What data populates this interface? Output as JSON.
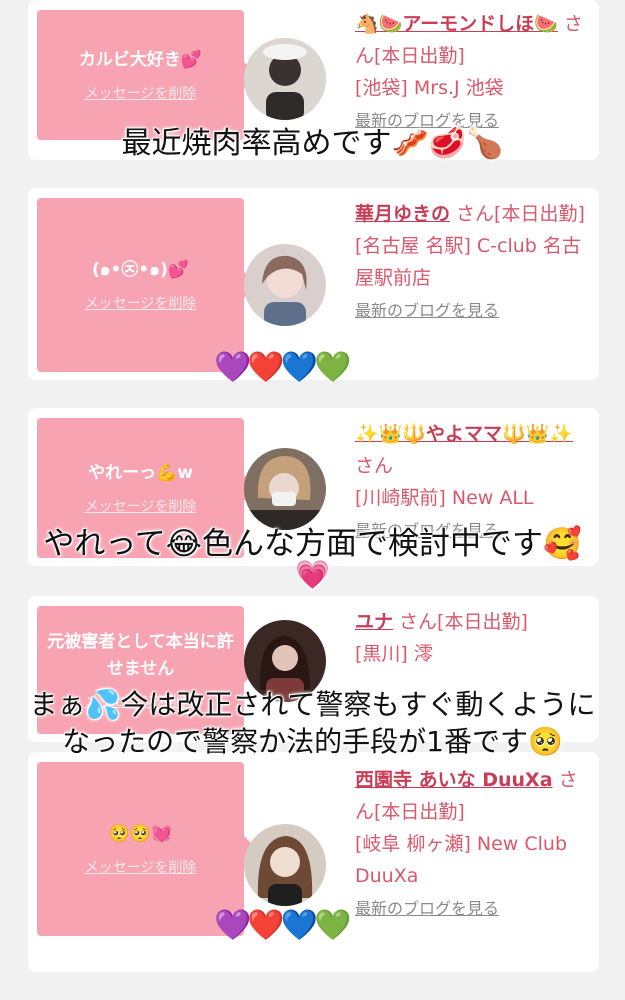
{
  "delete_label": "メッセージを削除",
  "blog_label": "最新のブログを見る",
  "cards": [
    {
      "message": "カルビ大好き💕",
      "name": "🐴🍉アーモンドしほ🍉",
      "san": " さん[本日出勤]",
      "shop": "[池袋] Mrs.J 池袋",
      "avatar_color": "#c9c2bd"
    },
    {
      "message": "(๑•㉨•๑)💕",
      "name": "華月ゆきの",
      "san": " さん[本日出勤]",
      "shop": "[名古屋 名駅] C-club 名古屋駅前店",
      "avatar_color": "#c7b7b4"
    },
    {
      "message": "やれーっ💪w",
      "name": "✨👑🔱やよママ🔱👑✨",
      "san": " さん",
      "shop": "[川崎駅前] New ALL",
      "avatar_color": "#8e7b6a"
    },
    {
      "message": "元被害者として本当に許せません",
      "name": "ユナ",
      "san": " さん[本日出勤]",
      "shop": "[黒川] 澪",
      "avatar_color": "#5a3b34"
    },
    {
      "message": "🥺🥺💓",
      "name": "西園寺 あいな DuuXa",
      "san": " さん[本日出勤]",
      "shop": "[岐阜 柳ヶ瀬] New Club DuuXa",
      "avatar_color": "#b49a88"
    }
  ],
  "overlays": {
    "line1": "最近焼肉率高めです🥓🥩🍗",
    "line2": "やれって😂色んな方面で検討中です🥰",
    "line2b": "💗",
    "line3a": "まぁ💦今は改正されて警察もすぐ動くように",
    "line3b": "なったので警察か法的手段が1番です🥺",
    "hearts": "💜❤️💙💚"
  }
}
